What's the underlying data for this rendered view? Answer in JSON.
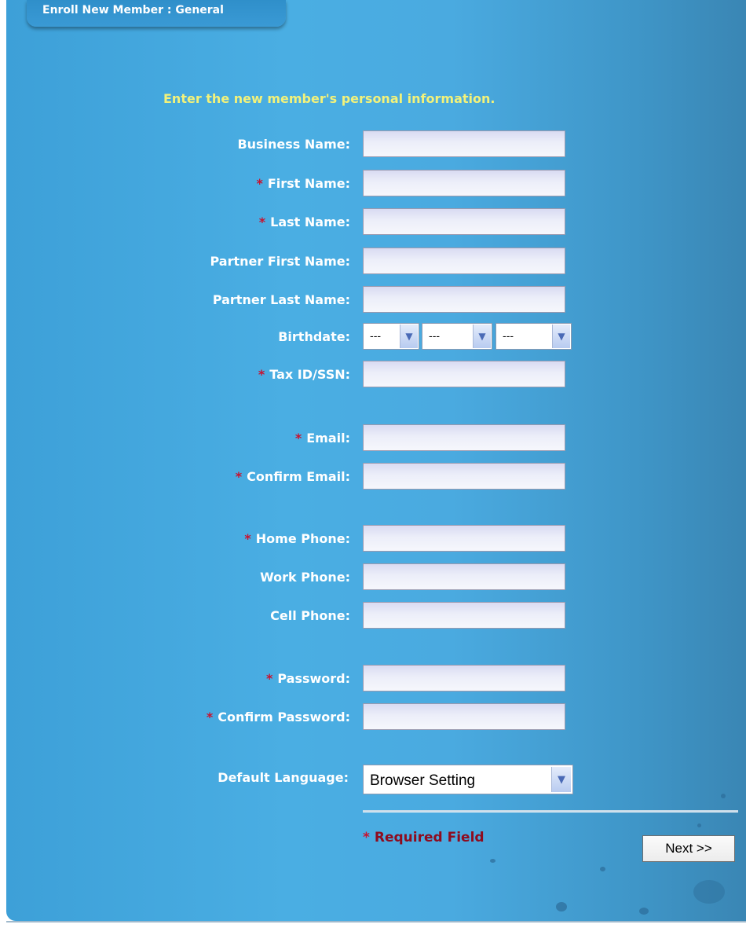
{
  "tab": {
    "title": "Enroll New Member : General"
  },
  "instruction": "Enter the new member's personal information.",
  "required_marker": "*",
  "fields": {
    "business_name": {
      "label": "Business Name:",
      "value": ""
    },
    "first_name": {
      "label": "First Name:",
      "value": ""
    },
    "last_name": {
      "label": "Last Name:",
      "value": ""
    },
    "partner_first_name": {
      "label": "Partner First Name:",
      "value": ""
    },
    "partner_last_name": {
      "label": "Partner Last Name:",
      "value": ""
    },
    "birthdate": {
      "label": "Birthdate:",
      "month": "---",
      "day": "---",
      "year": "---"
    },
    "tax_id": {
      "label": "Tax ID/SSN:",
      "value": ""
    },
    "email": {
      "label": "Email:",
      "value": ""
    },
    "confirm_email": {
      "label": "Confirm Email:",
      "value": ""
    },
    "home_phone": {
      "label": "Home Phone:",
      "value": ""
    },
    "work_phone": {
      "label": "Work Phone:",
      "value": ""
    },
    "cell_phone": {
      "label": "Cell Phone:",
      "value": ""
    },
    "password": {
      "label": "Password:",
      "value": ""
    },
    "confirm_password": {
      "label": "Confirm Password:",
      "value": ""
    },
    "default_language": {
      "label": "Default Language:",
      "selected": "Browser Setting"
    }
  },
  "required_note": "Required Field",
  "next_button": "Next >>",
  "icons": {
    "dropdown": "chevron-down-icon"
  },
  "colors": {
    "panel_blue": "#4aaee3",
    "instruction_yellow": "#f2f27a",
    "required_red": "#c9112e",
    "required_note_red": "#8e0b1e",
    "label_white": "#ffffff"
  }
}
